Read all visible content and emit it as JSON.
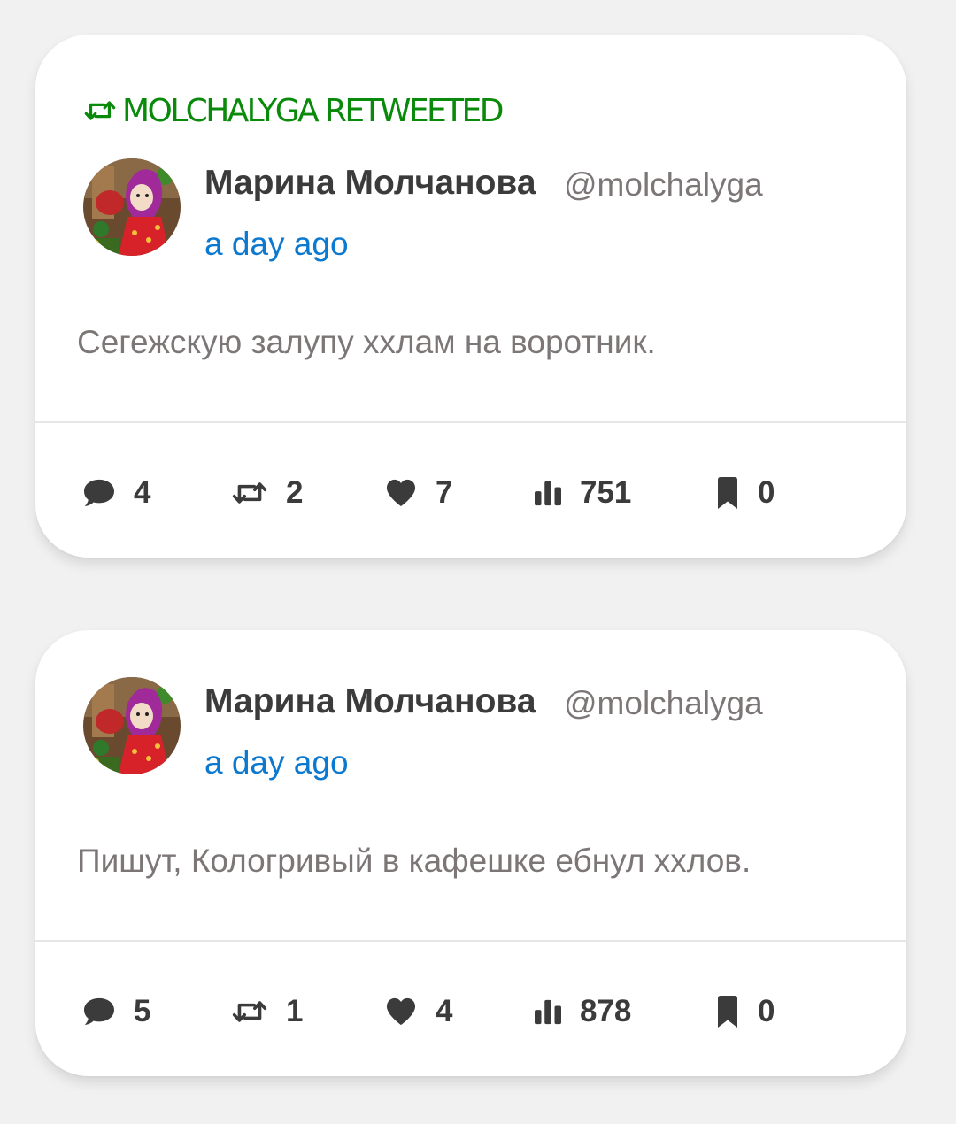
{
  "posts": [
    {
      "retweeted_by": "MOLCHALYGA RETWEETED",
      "author_name": "Марина Молчанова",
      "author_handle": "@molchalyga",
      "timestamp": "a day ago",
      "text": "Сегежскую залупу ххлам на воротник.",
      "counts": {
        "replies": "4",
        "retweets": "2",
        "likes": "7",
        "views": "751",
        "bookmarks": "0"
      }
    },
    {
      "author_name": "Марина Молчанова",
      "author_handle": "@molchalyga",
      "timestamp": "a day ago",
      "text": "Пишут, Кологривый в кафешке ебнул ххлов.",
      "counts": {
        "replies": "5",
        "retweets": "1",
        "likes": "4",
        "views": "878",
        "bookmarks": "0"
      }
    }
  ],
  "icons": {
    "retweet_banner": "retweet-icon",
    "reply": "comment-icon",
    "retweet": "retweet-icon",
    "like": "heart-icon",
    "views": "bar-chart-icon",
    "bookmark": "bookmark-icon"
  },
  "colors": {
    "background": "#f1f1f1",
    "card": "#ffffff",
    "retweet_green": "#0a8a0a",
    "link_blue": "#0b79d0",
    "name_text": "#3b3b3b",
    "muted_text": "#7c7676",
    "icon": "#3b3b3b"
  }
}
